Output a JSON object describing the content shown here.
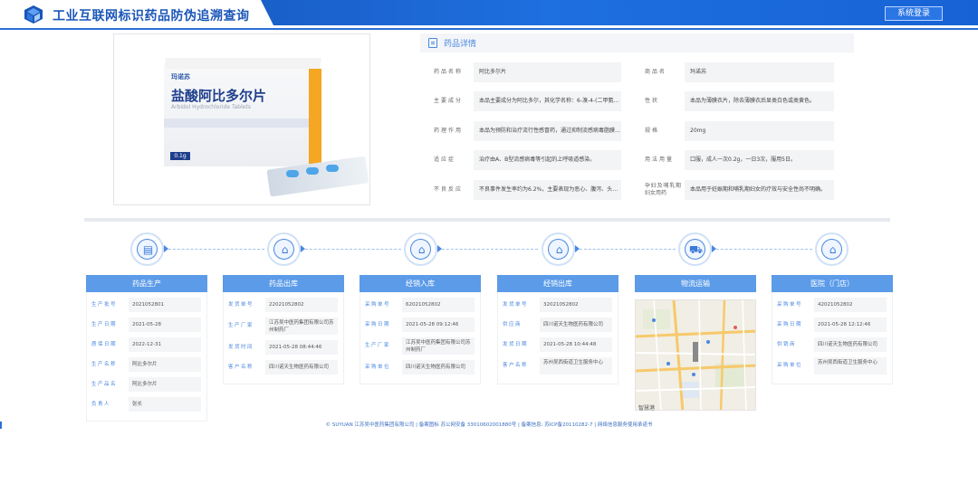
{
  "header": {
    "title": "工业互联网标识药品防伪追溯查询",
    "login_label": "系统登录",
    "logo_icon": "cube-logo-icon"
  },
  "product_image": {
    "brand": "玛诺苏",
    "name": "盐酸阿比多尔片",
    "english_name": "Arbidol Hydrochloride Tablets",
    "dose": "0.1g"
  },
  "details": {
    "title": "药品详情",
    "fields": [
      {
        "label": "药品名称",
        "value": "阿比多尔片"
      },
      {
        "label": "商品名",
        "value": "玛诺苏"
      },
      {
        "label": "主要成分",
        "value": "本品主要成分为阿比多尔，其化学名称：6-溴-4-(二甲氨基甲..."
      },
      {
        "label": "性状",
        "value": "本品为薄膜衣片，除去薄膜衣后显类白色或类黄色。"
      },
      {
        "label": "药理作用",
        "value": "本品为预防和治疗流行性感冒药，通过抑制流感病毒脂膜与..."
      },
      {
        "label": "规格",
        "value": "20mg"
      },
      {
        "label": "适应症",
        "value": "治疗由A、B型流感病毒等引起的上呼吸道感染。"
      },
      {
        "label": "用法用量",
        "value": "口服，成人一次0.2g，一日3次，服用5日。"
      },
      {
        "label": "不良反应",
        "value": "不良事件发生率约为6.2%，主要表现为恶心、腹泻、头晕和..."
      },
      {
        "label": "孕妇及哺乳期妇女用药",
        "value": "本品用于妊娠期和哺乳期妇女的疗效与安全性尚不明确。"
      }
    ]
  },
  "timeline": [
    {
      "title": "药品生产",
      "icon": "production-icon",
      "rows": [
        {
          "label": "生产批号",
          "value": "2021052801"
        },
        {
          "label": "生产日期",
          "value": "2021-05-28"
        },
        {
          "label": "质保日期",
          "value": "2022-12-31"
        },
        {
          "label": "生产名称",
          "value": "阿比多尔片"
        },
        {
          "label": "生产品名",
          "value": "阿比多尔片"
        },
        {
          "label": "负责人",
          "value": "张长"
        }
      ]
    },
    {
      "title": "药品出库",
      "icon": "store-icon",
      "rows": [
        {
          "label": "发货单号",
          "value": "22021052802"
        },
        {
          "label": "生产厂家",
          "value": "江苏吴中医药集团有限公司苏州制药厂"
        },
        {
          "label": "发货时间",
          "value": "2021-05-28 08:44:46"
        },
        {
          "label": "客户名称",
          "value": "四川诺天生物医药有限公司"
        }
      ]
    },
    {
      "title": "经销入库",
      "icon": "store-icon",
      "rows": [
        {
          "label": "采购单号",
          "value": "62021052802"
        },
        {
          "label": "采购日期",
          "value": "2021-05-28 09:12:46"
        },
        {
          "label": "生产厂家",
          "value": "江苏吴中医药集团有限公司苏州制药厂"
        },
        {
          "label": "采购单位",
          "value": "四川诺天生物医药有限公司"
        }
      ]
    },
    {
      "title": "经销出库",
      "icon": "store-icon",
      "rows": [
        {
          "label": "发货单号",
          "value": "32021052802"
        },
        {
          "label": "供应商",
          "value": "四川诺天生物医药有限公司"
        },
        {
          "label": "发货日期",
          "value": "2021-05-28 10:44:48"
        },
        {
          "label": "客户名称",
          "value": "苏州吴西街道卫生服务中心"
        }
      ]
    },
    {
      "title": "物流运输",
      "icon": "truck-icon",
      "map_caption": "智慧港"
    },
    {
      "title": "医院（门店）",
      "icon": "store-icon",
      "rows": [
        {
          "label": "采购单号",
          "value": "42021052802"
        },
        {
          "label": "采购日期",
          "value": "2021-05-28 12:12:46"
        },
        {
          "label": "供销商",
          "value": "四川诺天生物医药有限公司"
        },
        {
          "label": "采购单位",
          "value": "苏州吴西街道卫生服务中心"
        }
      ]
    }
  ],
  "footer": {
    "text": "© SUYUAN 江苏吴中医药集团有限公司 | 备案图标 苏公网安备 33010602001880号 | 备案信息: 苏ICP备20110282-7 | 网络信息服务使用承诺书"
  },
  "colors": {
    "primary": "#1b56b8",
    "accent": "#4a88e0",
    "card_head": "#5b9be8"
  }
}
